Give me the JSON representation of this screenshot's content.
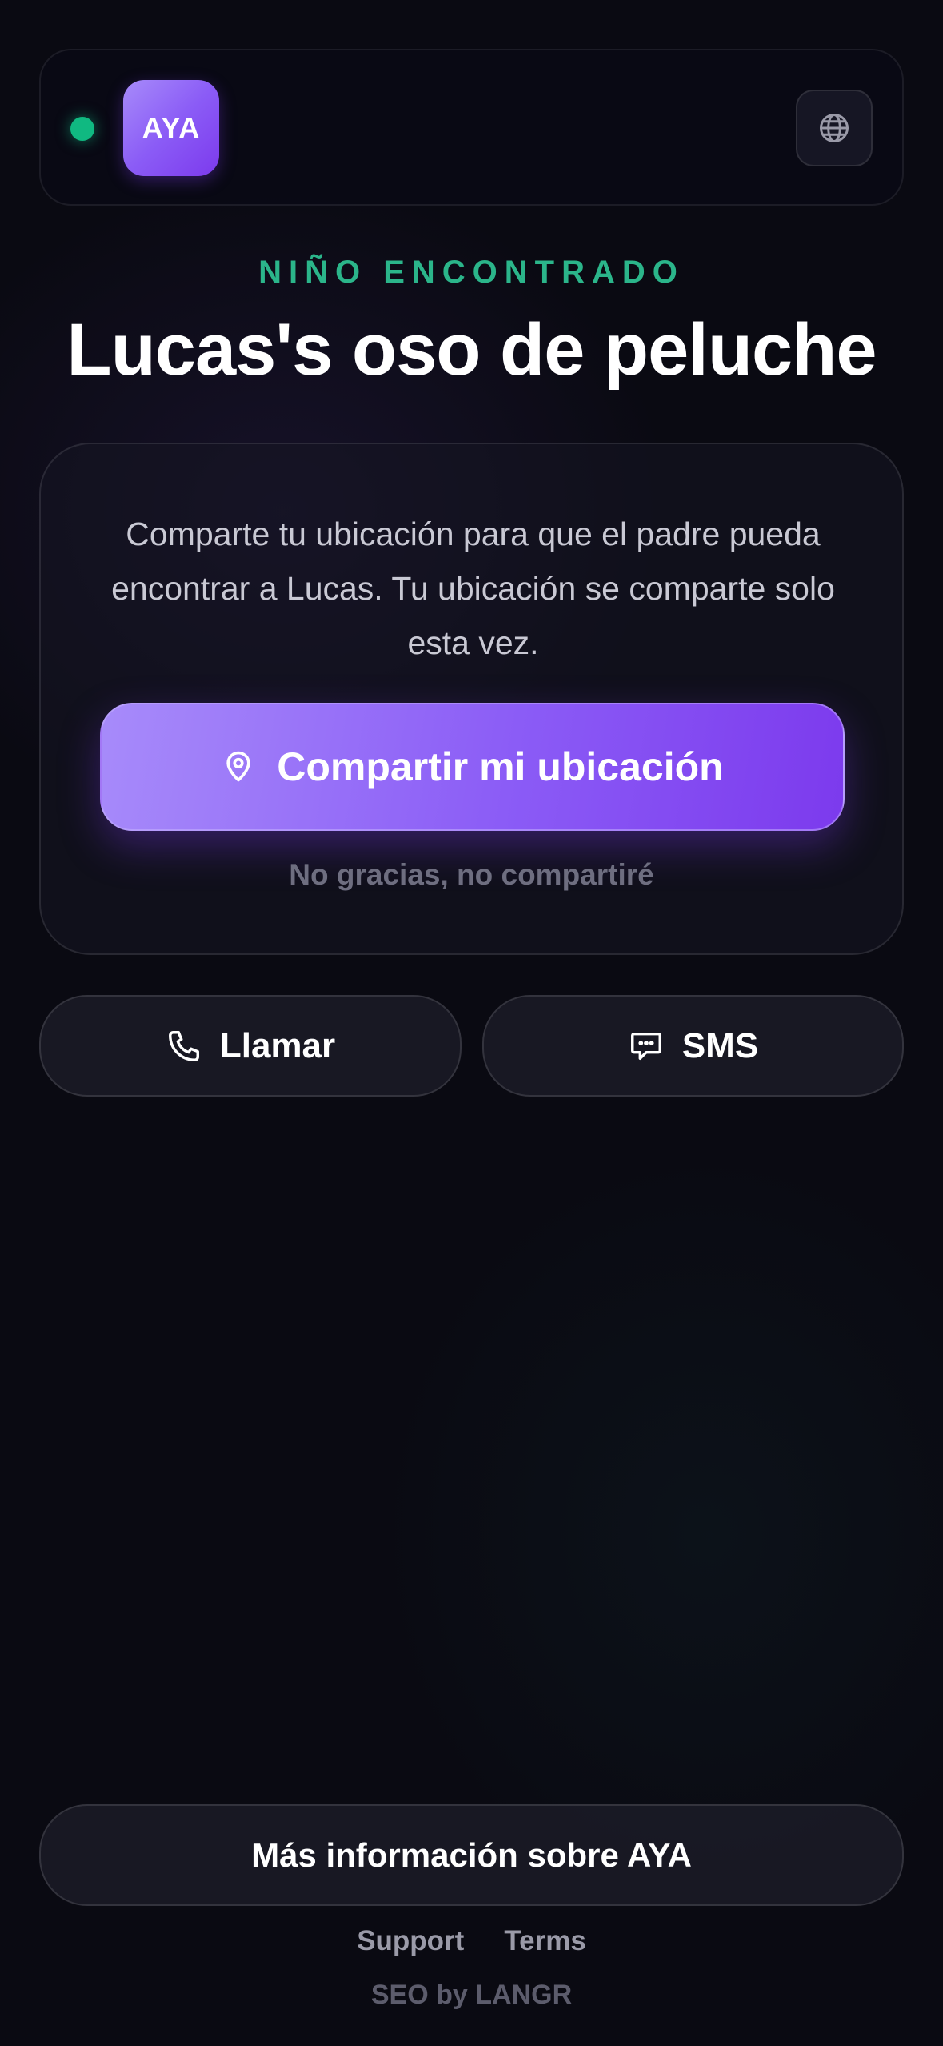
{
  "header": {
    "status_dot_color": "#10b981",
    "logo_text": "AYA",
    "language_icon": "globe-icon"
  },
  "hero": {
    "eyebrow": "NIÑO ENCONTRADO",
    "title": "Lucas's oso de peluche"
  },
  "card": {
    "description": "Comparte tu ubicación para que el padre pueda encontrar a Lucas. Tu ubicación se comparte solo esta vez.",
    "share_button_label": "Compartir mi ubicación",
    "share_button_icon": "map-pin-icon",
    "decline_label": "No gracias, no compartiré"
  },
  "actions": {
    "call_label": "Llamar",
    "call_icon": "phone-icon",
    "sms_label": "SMS",
    "sms_icon": "chat-bubble-icon"
  },
  "footer": {
    "more_info_label": "Más información sobre AYA",
    "links": [
      "Support",
      "Terms"
    ],
    "credit": "SEO by LANGR"
  },
  "colors": {
    "accent": "#8b5cf6",
    "eyebrow": "#2bb58a",
    "background": "#0a0a12"
  }
}
